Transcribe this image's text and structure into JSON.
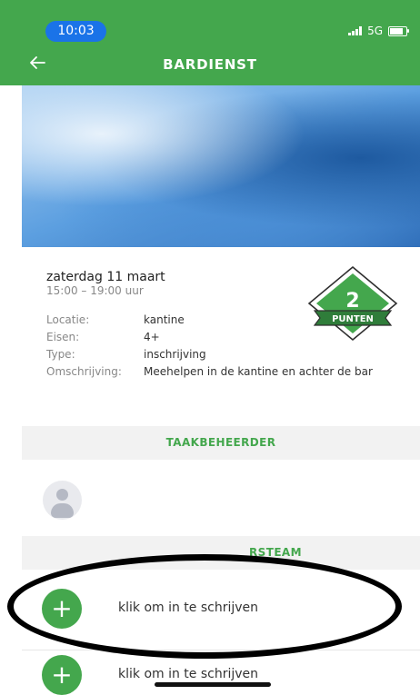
{
  "status_bar": {
    "time": "10:03",
    "network": "5G"
  },
  "header": {
    "title": "BARDIENST"
  },
  "task": {
    "date": "zaterdag 11 maart",
    "time_range": "15:00 – 19:00 uur",
    "points": {
      "value": "2",
      "label": "PUNTEN"
    },
    "details": [
      {
        "label": "Locatie:",
        "value": "kantine"
      },
      {
        "label": "Eisen:",
        "value": "4+"
      },
      {
        "label": "Type:",
        "value": "inschrijving"
      },
      {
        "label": "Omschrijving:",
        "value": "Meehelpen in de kantine en achter de bar"
      }
    ]
  },
  "sections": {
    "taakbeheerder": "TAAKBEHEERDER",
    "team_partial": "RSTEAM"
  },
  "signup": [
    {
      "label": "klik om in te schrijven"
    },
    {
      "label": "klik om in te schrijven"
    }
  ],
  "colors": {
    "brand_green": "#44a74d",
    "badge_dark_green": "#2f7d3a",
    "time_pill_blue": "#1a73e8"
  },
  "icons": {
    "back": "arrow-left-icon",
    "add": "plus-icon",
    "avatar": "user-avatar-icon"
  }
}
